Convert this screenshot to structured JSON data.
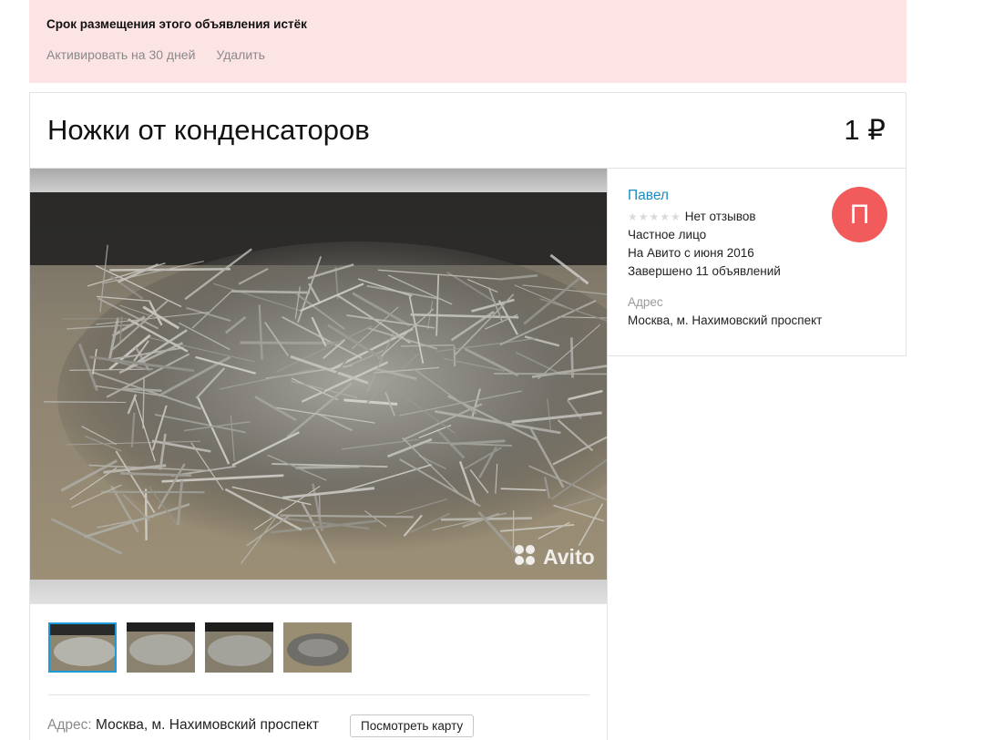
{
  "notice": {
    "title": "Срок размещения этого объявления истёк",
    "activate_label": "Активировать на 30 дней",
    "delete_label": "Удалить"
  },
  "listing": {
    "title": "Ножки от конденсаторов",
    "price": "1 ₽",
    "watermark": "Avito",
    "thumbnails_count": 4,
    "active_thumbnail": 1,
    "address_label": "Адрес:",
    "address": "Москва, м. Нахимовский проспект",
    "map_button_label": "Посмотреть карту"
  },
  "seller": {
    "name": "Павел",
    "reviews": "Нет отзывов",
    "type": "Частное лицо",
    "since": "На Авито с июня 2016",
    "completed": "Завершено 11 объявлений",
    "avatar_letter": "П",
    "avatar_color": "#f15b5b",
    "address_label": "Адрес",
    "address": "Москва, м. Нахимовский проспект"
  }
}
